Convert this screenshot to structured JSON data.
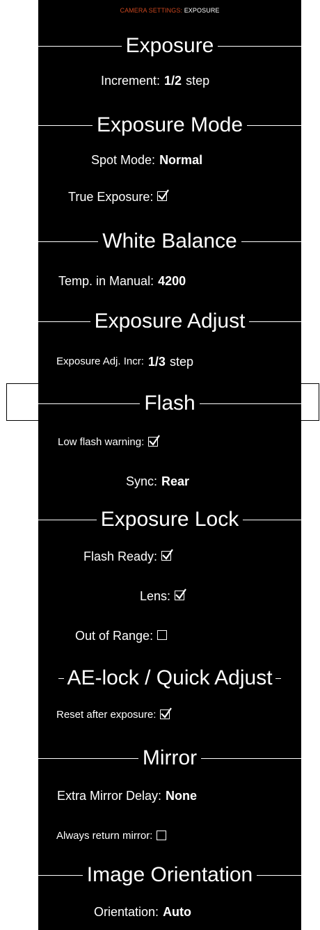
{
  "breadcrumb": {
    "parent": "CAMERA SETTINGS:",
    "current": "EXPOSURE"
  },
  "colors": {
    "background": "#000000",
    "text": "#ffffff",
    "breadcrumb_accent": "#c8461f"
  },
  "sections": {
    "exposure": {
      "title": "Exposure",
      "increment": {
        "label": "Increment:",
        "value": "1/2",
        "unit": "step"
      }
    },
    "exposure_mode": {
      "title": "Exposure Mode",
      "spot_mode": {
        "label": "Spot Mode:",
        "value": "Normal"
      },
      "true_exposure": {
        "label": "True Exposure:",
        "checked": true
      }
    },
    "white_balance": {
      "title": "White Balance",
      "temp_manual": {
        "label": "Temp. in Manual:",
        "value": "4200"
      }
    },
    "exposure_adjust": {
      "title": "Exposure Adjust",
      "adj_incr": {
        "label": "Exposure Adj. Incr:",
        "value": "1/3",
        "unit": "step"
      }
    },
    "flash": {
      "title": "Flash",
      "selected": true,
      "low_flash_warning": {
        "label": "Low flash warning:",
        "checked": true
      },
      "sync": {
        "label": "Sync:",
        "value": "Rear"
      }
    },
    "exposure_lock": {
      "title": "Exposure Lock",
      "flash_ready": {
        "label": "Flash Ready:",
        "checked": true
      },
      "lens": {
        "label": "Lens:",
        "checked": true
      },
      "out_of_range": {
        "label": "Out of Range:",
        "checked": false
      }
    },
    "ae_lock": {
      "title": "AE-lock / Quick Adjust",
      "reset_after_exposure": {
        "label": "Reset after exposure:",
        "checked": true
      }
    },
    "mirror": {
      "title": "Mirror",
      "extra_delay": {
        "label": "Extra Mirror Delay:",
        "value": "None"
      },
      "always_return": {
        "label": "Always return mirror:",
        "checked": false
      }
    },
    "image_orientation": {
      "title": "Image Orientation",
      "orientation": {
        "label": "Orientation:",
        "value": "Auto"
      }
    }
  }
}
